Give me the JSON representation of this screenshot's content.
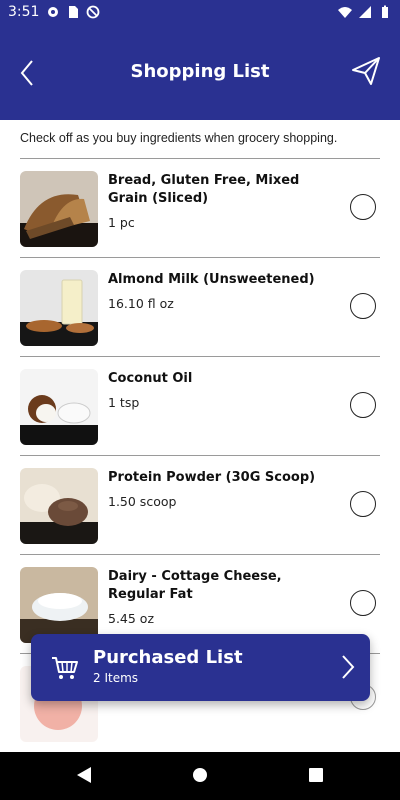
{
  "status_bar": {
    "time": "3:51",
    "left_icons": [
      "gear-icon",
      "sd-card-icon",
      "no-sync-icon"
    ],
    "right_icons": [
      "wifi-icon",
      "signal-icon",
      "battery-icon"
    ]
  },
  "header": {
    "title": "Shopping List",
    "background": "#2a3191"
  },
  "subtitle": "Check off as you buy ingredients when grocery shopping.",
  "items": [
    {
      "name": "Bread, Gluten Free, Mixed Grain (Sliced)",
      "quantity": "1 pc",
      "checked": false
    },
    {
      "name": "Almond Milk (Unsweetened)",
      "quantity": "16.10 fl oz",
      "checked": false
    },
    {
      "name": "Coconut Oil",
      "quantity": "1 tsp",
      "checked": false
    },
    {
      "name": "Protein Powder (30G Scoop)",
      "quantity": "1.50 scoop",
      "checked": false
    },
    {
      "name": "Dairy - Cottage Cheese, Regular Fat",
      "quantity": "5.45 oz",
      "checked": false
    }
  ],
  "purchased": {
    "title": "Purchased List",
    "count_label": "2 Items"
  },
  "nav": [
    "back-triangle-icon",
    "home-circle-icon",
    "recents-square-icon"
  ]
}
